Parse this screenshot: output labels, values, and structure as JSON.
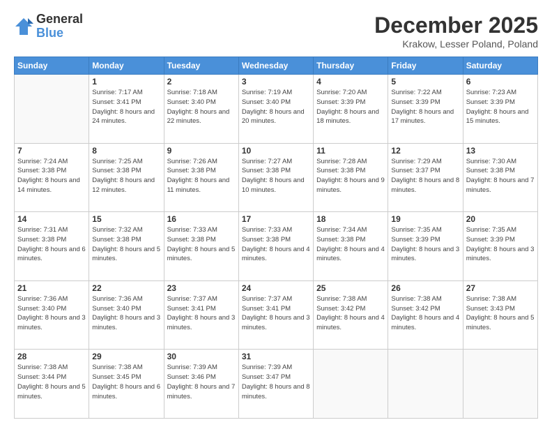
{
  "logo": {
    "general": "General",
    "blue": "Blue"
  },
  "title": "December 2025",
  "location": "Krakow, Lesser Poland, Poland",
  "weekdays": [
    "Sunday",
    "Monday",
    "Tuesday",
    "Wednesday",
    "Thursday",
    "Friday",
    "Saturday"
  ],
  "weeks": [
    [
      {
        "day": null,
        "info": null
      },
      {
        "day": "1",
        "sunrise": "7:17 AM",
        "sunset": "3:41 PM",
        "daylight": "8 hours and 24 minutes."
      },
      {
        "day": "2",
        "sunrise": "7:18 AM",
        "sunset": "3:40 PM",
        "daylight": "8 hours and 22 minutes."
      },
      {
        "day": "3",
        "sunrise": "7:19 AM",
        "sunset": "3:40 PM",
        "daylight": "8 hours and 20 minutes."
      },
      {
        "day": "4",
        "sunrise": "7:20 AM",
        "sunset": "3:39 PM",
        "daylight": "8 hours and 18 minutes."
      },
      {
        "day": "5",
        "sunrise": "7:22 AM",
        "sunset": "3:39 PM",
        "daylight": "8 hours and 17 minutes."
      },
      {
        "day": "6",
        "sunrise": "7:23 AM",
        "sunset": "3:39 PM",
        "daylight": "8 hours and 15 minutes."
      }
    ],
    [
      {
        "day": "7",
        "sunrise": "7:24 AM",
        "sunset": "3:38 PM",
        "daylight": "8 hours and 14 minutes."
      },
      {
        "day": "8",
        "sunrise": "7:25 AM",
        "sunset": "3:38 PM",
        "daylight": "8 hours and 12 minutes."
      },
      {
        "day": "9",
        "sunrise": "7:26 AM",
        "sunset": "3:38 PM",
        "daylight": "8 hours and 11 minutes."
      },
      {
        "day": "10",
        "sunrise": "7:27 AM",
        "sunset": "3:38 PM",
        "daylight": "8 hours and 10 minutes."
      },
      {
        "day": "11",
        "sunrise": "7:28 AM",
        "sunset": "3:38 PM",
        "daylight": "8 hours and 9 minutes."
      },
      {
        "day": "12",
        "sunrise": "7:29 AM",
        "sunset": "3:37 PM",
        "daylight": "8 hours and 8 minutes."
      },
      {
        "day": "13",
        "sunrise": "7:30 AM",
        "sunset": "3:38 PM",
        "daylight": "8 hours and 7 minutes."
      }
    ],
    [
      {
        "day": "14",
        "sunrise": "7:31 AM",
        "sunset": "3:38 PM",
        "daylight": "8 hours and 6 minutes."
      },
      {
        "day": "15",
        "sunrise": "7:32 AM",
        "sunset": "3:38 PM",
        "daylight": "8 hours and 5 minutes."
      },
      {
        "day": "16",
        "sunrise": "7:33 AM",
        "sunset": "3:38 PM",
        "daylight": "8 hours and 5 minutes."
      },
      {
        "day": "17",
        "sunrise": "7:33 AM",
        "sunset": "3:38 PM",
        "daylight": "8 hours and 4 minutes."
      },
      {
        "day": "18",
        "sunrise": "7:34 AM",
        "sunset": "3:38 PM",
        "daylight": "8 hours and 4 minutes."
      },
      {
        "day": "19",
        "sunrise": "7:35 AM",
        "sunset": "3:39 PM",
        "daylight": "8 hours and 3 minutes."
      },
      {
        "day": "20",
        "sunrise": "7:35 AM",
        "sunset": "3:39 PM",
        "daylight": "8 hours and 3 minutes."
      }
    ],
    [
      {
        "day": "21",
        "sunrise": "7:36 AM",
        "sunset": "3:40 PM",
        "daylight": "8 hours and 3 minutes."
      },
      {
        "day": "22",
        "sunrise": "7:36 AM",
        "sunset": "3:40 PM",
        "daylight": "8 hours and 3 minutes."
      },
      {
        "day": "23",
        "sunrise": "7:37 AM",
        "sunset": "3:41 PM",
        "daylight": "8 hours and 3 minutes."
      },
      {
        "day": "24",
        "sunrise": "7:37 AM",
        "sunset": "3:41 PM",
        "daylight": "8 hours and 3 minutes."
      },
      {
        "day": "25",
        "sunrise": "7:38 AM",
        "sunset": "3:42 PM",
        "daylight": "8 hours and 4 minutes."
      },
      {
        "day": "26",
        "sunrise": "7:38 AM",
        "sunset": "3:42 PM",
        "daylight": "8 hours and 4 minutes."
      },
      {
        "day": "27",
        "sunrise": "7:38 AM",
        "sunset": "3:43 PM",
        "daylight": "8 hours and 5 minutes."
      }
    ],
    [
      {
        "day": "28",
        "sunrise": "7:38 AM",
        "sunset": "3:44 PM",
        "daylight": "8 hours and 5 minutes."
      },
      {
        "day": "29",
        "sunrise": "7:38 AM",
        "sunset": "3:45 PM",
        "daylight": "8 hours and 6 minutes."
      },
      {
        "day": "30",
        "sunrise": "7:39 AM",
        "sunset": "3:46 PM",
        "daylight": "8 hours and 7 minutes."
      },
      {
        "day": "31",
        "sunrise": "7:39 AM",
        "sunset": "3:47 PM",
        "daylight": "8 hours and 8 minutes."
      },
      {
        "day": null,
        "info": null
      },
      {
        "day": null,
        "info": null
      },
      {
        "day": null,
        "info": null
      }
    ]
  ]
}
